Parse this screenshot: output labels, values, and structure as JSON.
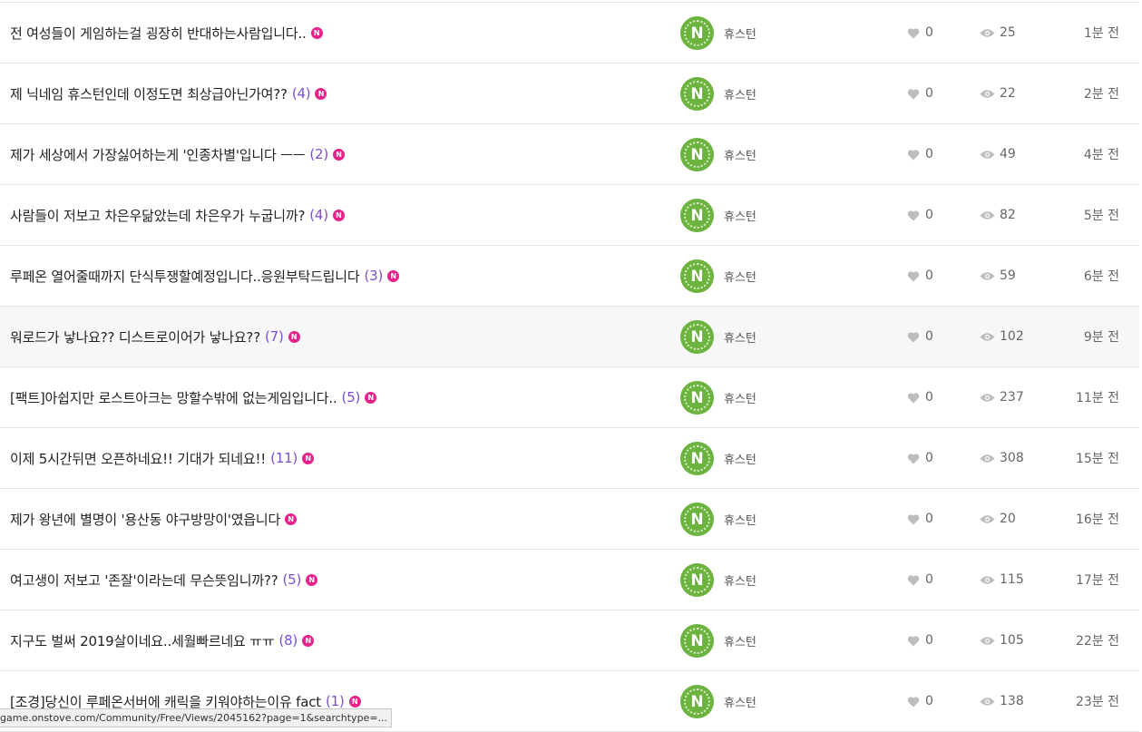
{
  "new_badge": "N",
  "avatar_letter": "N",
  "posts": [
    {
      "title": "전 여성들이 게임하는걸 굉장히 반대하는사람입니다..",
      "count": "",
      "author": "휴스턴",
      "likes": "0",
      "views": "25",
      "time": "1분 전"
    },
    {
      "title": "제 닉네임 휴스턴인데 이정도면 최상급아닌가여??",
      "count": "(4)",
      "author": "휴스턴",
      "likes": "0",
      "views": "22",
      "time": "2분 전"
    },
    {
      "title": "제가 세상에서 가장싫어하는게 '인종차별'입니다 ㅡㅡ",
      "count": "(2)",
      "author": "휴스턴",
      "likes": "0",
      "views": "49",
      "time": "4분 전"
    },
    {
      "title": "사람들이 저보고 차은우닮았는데 차은우가 누굽니까?",
      "count": "(4)",
      "author": "휴스턴",
      "likes": "0",
      "views": "82",
      "time": "5분 전"
    },
    {
      "title": "루페온 열어줄때까지 단식투쟁할예정입니다..응원부탁드립니다",
      "count": "(3)",
      "author": "휴스턴",
      "likes": "0",
      "views": "59",
      "time": "6분 전"
    },
    {
      "title": "워로드가 낳나요?? 디스트로이어가 낳나요??",
      "count": "(7)",
      "author": "휴스턴",
      "likes": "0",
      "views": "102",
      "time": "9분 전"
    },
    {
      "title": "[팩트]아쉽지만 로스트아크는 망할수밖에 없는게임입니다..",
      "count": "(5)",
      "author": "휴스턴",
      "likes": "0",
      "views": "237",
      "time": "11분 전"
    },
    {
      "title": "이제 5시간뒤면 오픈하네요!! 기대가 되네요!!",
      "count": "(11)",
      "author": "휴스턴",
      "likes": "0",
      "views": "308",
      "time": "15분 전"
    },
    {
      "title": "제가 왕년에 별명이 '용산동 야구방망이'였읍니다",
      "count": "",
      "author": "휴스턴",
      "likes": "0",
      "views": "20",
      "time": "16분 전"
    },
    {
      "title": "여고생이 저보고 '존잘'이라는데 무슨뜻임니까??",
      "count": "(5)",
      "author": "휴스턴",
      "likes": "0",
      "views": "115",
      "time": "17분 전"
    },
    {
      "title": "지구도 벌써 2019살이네요..세월빠르네요 ㅠㅠ",
      "count": "(8)",
      "author": "휴스턴",
      "likes": "0",
      "views": "105",
      "time": "22분 전"
    },
    {
      "title": "[조경]당신이 루페온서버에 캐릭을 키워야하는이유 fact",
      "count": "(1)",
      "author": "휴스턴",
      "likes": "0",
      "views": "138",
      "time": "23분 전"
    }
  ],
  "status_bar": {
    "url": "game.onstove.com/Community/Free/Views/2045162?page=1&searchtype=..."
  },
  "colors": {
    "comment_count": "#7a4fd6",
    "new_badge": "#e8228a",
    "avatar": "#6db33f",
    "hover_row": "#f7f7f7"
  },
  "icons": {
    "likes": "heart-icon",
    "views": "eye-icon"
  }
}
